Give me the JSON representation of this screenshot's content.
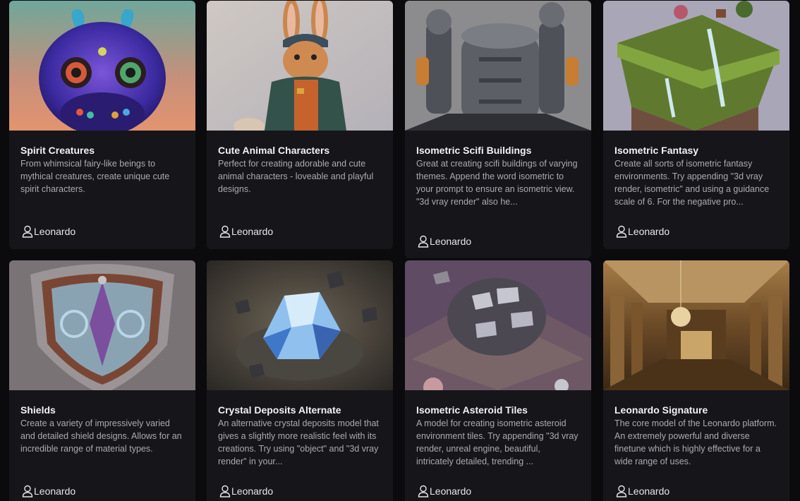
{
  "cards": [
    {
      "title": "Spirit Creatures",
      "description": "From whimsical fairy-like beings to mythical creatures, create unique cute spirit characters.",
      "author": "Leonardo",
      "image_icon": "monster-creature-image"
    },
    {
      "title": "Cute Animal Characters",
      "description": "Perfect for creating adorable and cute animal characters - loveable and playful designs.",
      "author": "Leonardo",
      "image_icon": "rabbit-character-image"
    },
    {
      "title": "Isometric Scifi Buildings",
      "description": "Great at creating scifi buildings of varying themes. Append the word isometric to your prompt to ensure an isometric view. \"3d vray render\" also he...",
      "author": "Leonardo",
      "image_icon": "scifi-building-image"
    },
    {
      "title": "Isometric Fantasy",
      "description": "Create all sorts of isometric fantasy environments. Try appending \"3d vray render, isometric\" and using a guidance scale of 6. For the negative pro...",
      "author": "Leonardo",
      "image_icon": "fantasy-island-image"
    },
    {
      "title": "Shields",
      "description": "Create a variety of impressively varied and detailed shield designs. Allows for an incredible range of material types.",
      "author": "Leonardo",
      "image_icon": "shield-image"
    },
    {
      "title": "Crystal Deposits Alternate",
      "description": "An alternative crystal deposits model that gives a slightly more realistic feel with its creations. Try using \"object\" and \"3d vray render\" in your...",
      "author": "Leonardo",
      "image_icon": "crystal-image"
    },
    {
      "title": "Isometric Asteroid Tiles",
      "description": "A model for creating isometric asteroid environment tiles. Try appending \"3d vray render, unreal engine, beautiful, intricately detailed, trending ...",
      "author": "Leonardo",
      "image_icon": "asteroid-tile-image"
    },
    {
      "title": "Leonardo Signature",
      "description": "The core model of the Leonardo platform. An extremely powerful and diverse finetune which is highly effective for a wide range of uses.",
      "author": "Leonardo",
      "image_icon": "palace-hall-image"
    }
  ]
}
